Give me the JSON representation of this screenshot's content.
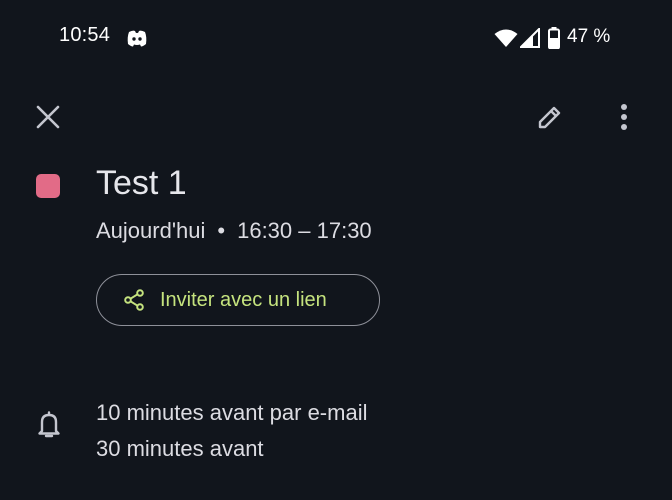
{
  "status_bar": {
    "time": "10:54",
    "battery_text": "47 %",
    "icons": [
      "discord-icon",
      "wifi-icon",
      "signal-icon",
      "battery-icon"
    ]
  },
  "toolbar": {
    "icons": [
      "close-icon",
      "edit-pencil-icon",
      "more-vert-icon"
    ]
  },
  "event": {
    "color": "#e26b87",
    "title": "Test 1",
    "date": "Aujourd'hui",
    "separator": "•",
    "time_range": "16:30 – 17:30"
  },
  "invite": {
    "label": "Inviter avec un lien",
    "icon": "share-icon",
    "accent_color": "#c5e37e"
  },
  "reminders": {
    "icon": "bell-icon",
    "items": [
      "10 minutes avant par e-mail",
      "30 minutes avant"
    ]
  }
}
